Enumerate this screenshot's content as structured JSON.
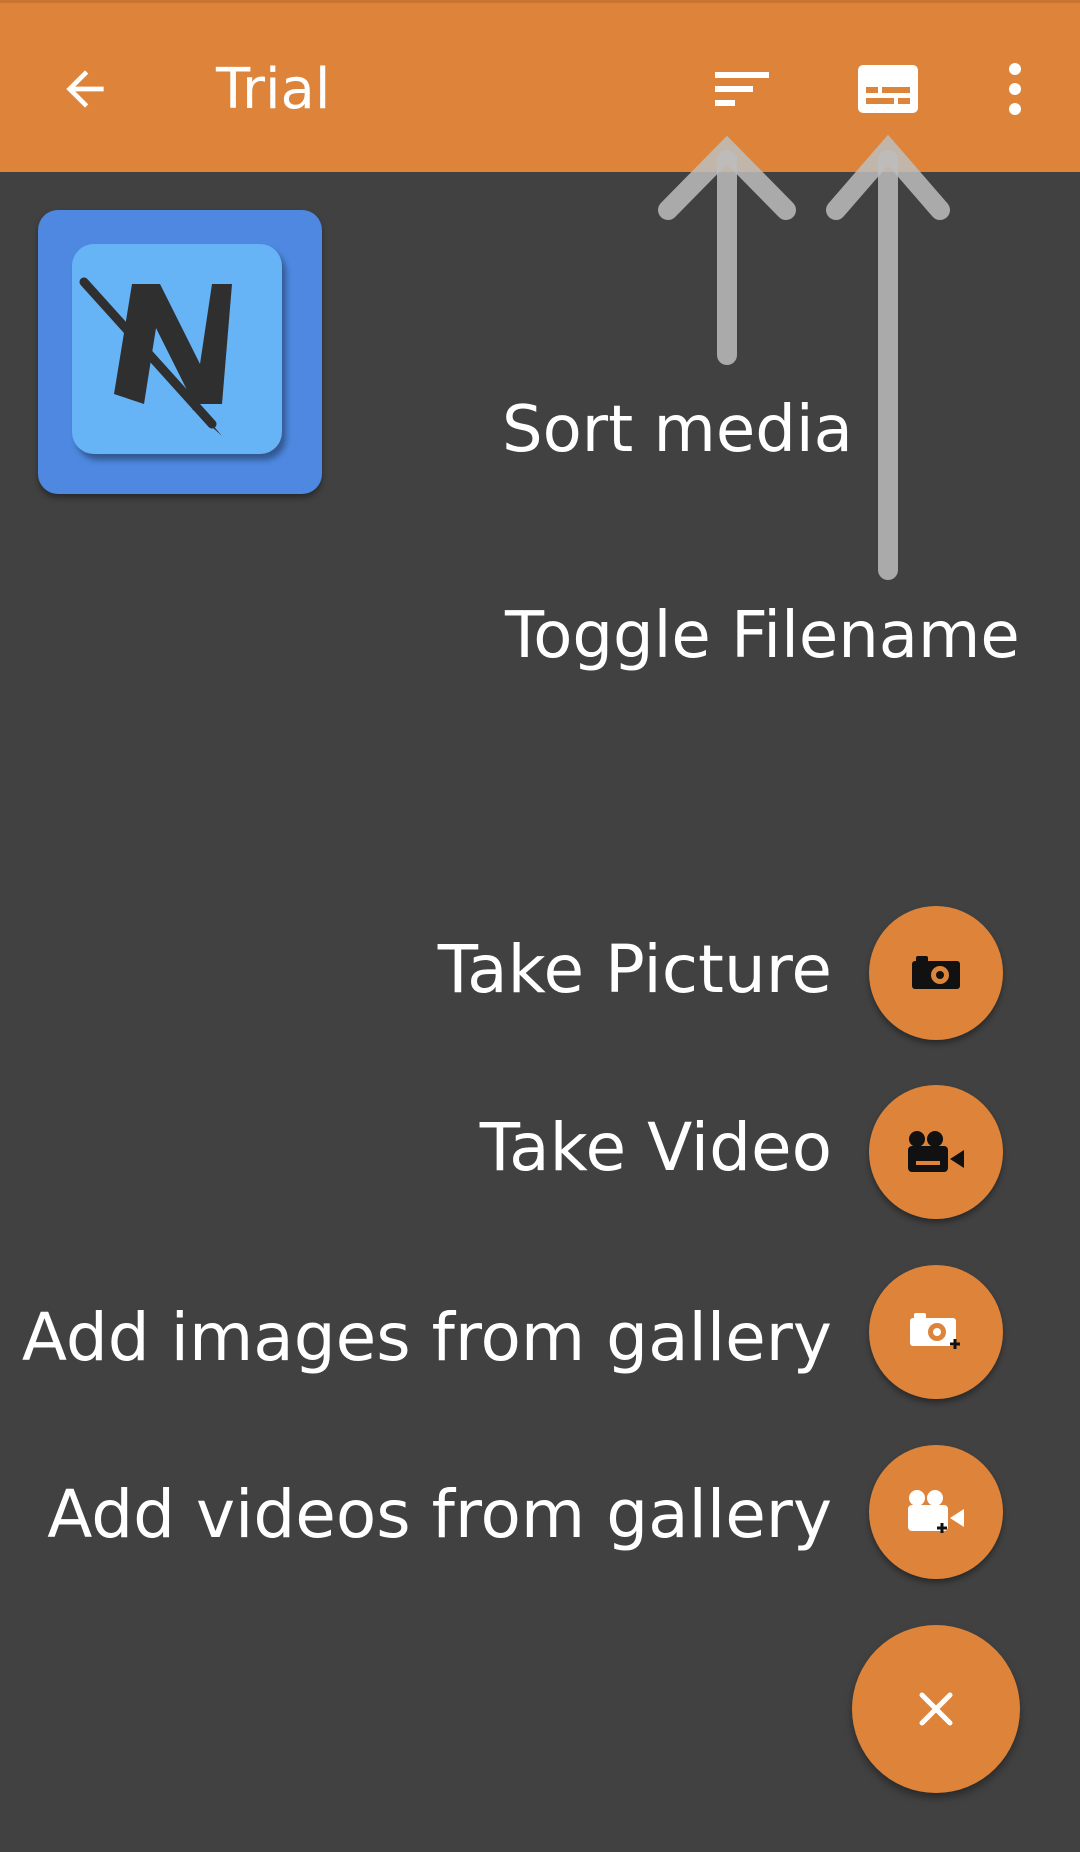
{
  "appbar": {
    "title": "Trial",
    "background_color": "#DD843A",
    "icons": [
      "arrow-back-icon",
      "sort-icon",
      "subtitles-icon",
      "more-vert-icon"
    ]
  },
  "tutorial": {
    "sort_label": "Sort media",
    "toggle_label": "Toggle Filename"
  },
  "fab_menu": {
    "items": [
      {
        "label": "Take Picture",
        "icon": "camera-icon"
      },
      {
        "label": "Take Video",
        "icon": "video-camera-icon"
      },
      {
        "label": "Add images from gallery",
        "icon": "add-image-icon"
      },
      {
        "label": "Add videos from gallery",
        "icon": "add-video-icon"
      }
    ],
    "close_icon": "close-icon",
    "accent_color": "#DD843A"
  },
  "background_color": "#414141"
}
